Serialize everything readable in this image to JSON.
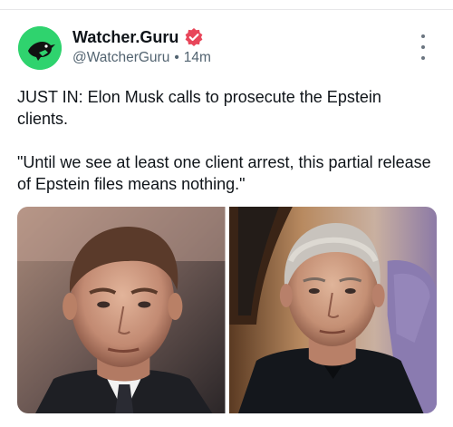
{
  "post": {
    "author": {
      "display_name": "Watcher.Guru",
      "handle": "@WatcherGuru",
      "time": "14m",
      "separator": "•"
    },
    "icons": {
      "avatar": "raven-logo-icon",
      "verified": "verified-badge-icon",
      "more": "more-vertical-icon"
    },
    "colors": {
      "avatar_bg": "#2fd36e",
      "verified": "#e8465a",
      "secondary_text": "#536471"
    },
    "text": {
      "line1": "JUST IN: Elon Musk calls to prosecute the Epstein clients.",
      "line2": "\"Until we see at least one client arrest, this partial release of Epstein files means nothing.\""
    },
    "media": [
      {
        "description_icon": "photo-elon-musk"
      },
      {
        "description_icon": "photo-jeffrey-epstein"
      }
    ]
  }
}
